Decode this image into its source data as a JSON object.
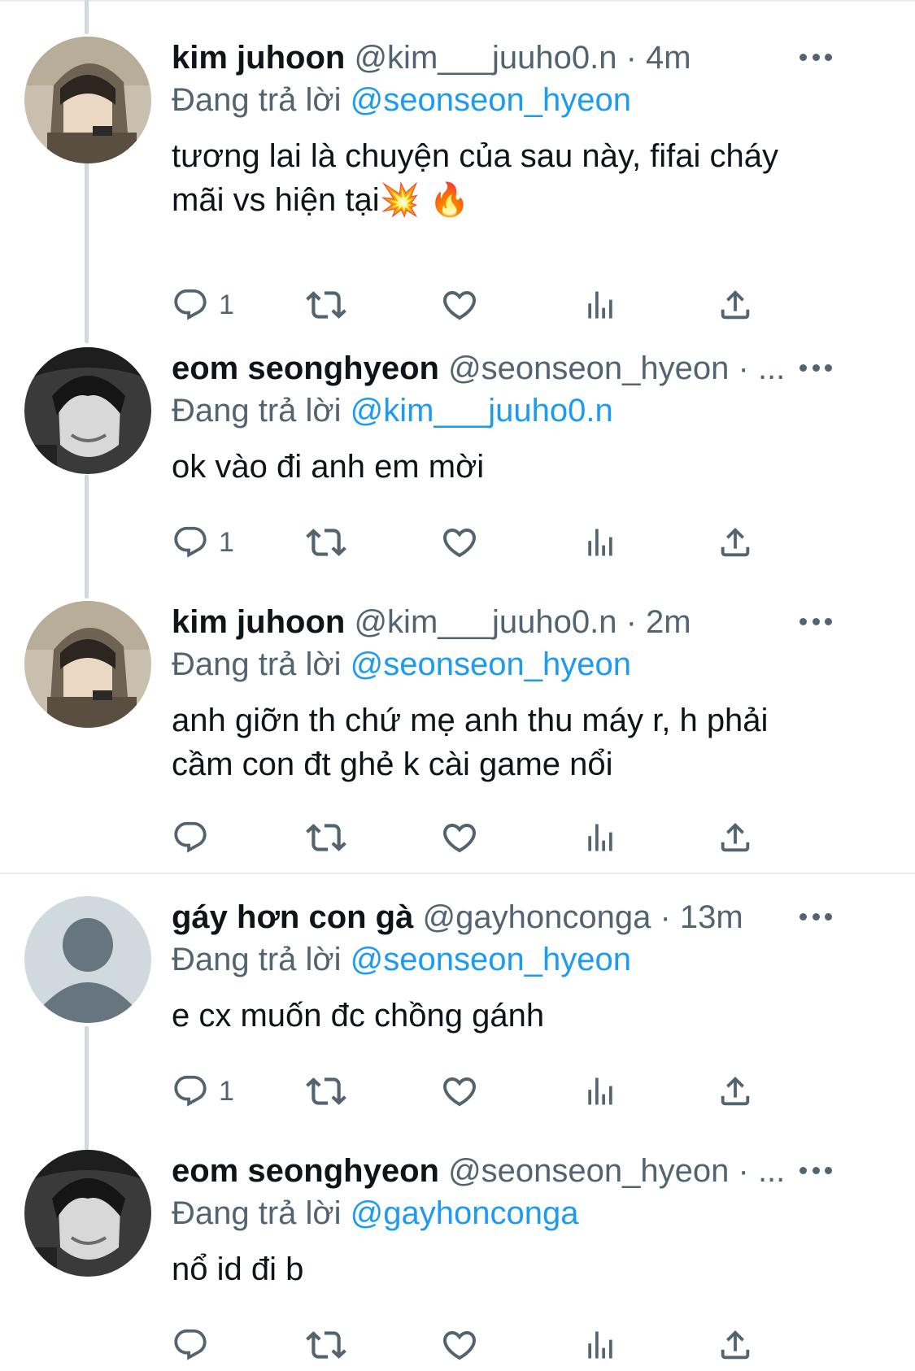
{
  "replying_label": "Đang trả lời",
  "tweets": [
    {
      "name": "kim juhoon",
      "handle": "@kim___juuho0.n",
      "sep": " · ",
      "time": "4m",
      "reply_to": "@seonseon_hyeon",
      "text": "tương lai là chuyện của sau này, fifai cháy\nmãi vs hiện tại💥 🔥",
      "reply_count": "1",
      "avatar": "photo-hooded-person"
    },
    {
      "name": "eom seonghyeon",
      "handle": "@seonseon_hyeon",
      "sep": " · ",
      "time": "...",
      "reply_to": "@kim___juuho0.n",
      "text": "ok vào đi anh em mời",
      "reply_count": "1",
      "avatar": "photo-grayscale-person"
    },
    {
      "name": "kim juhoon",
      "handle": "@kim___juuho0.n",
      "sep": " · ",
      "time": "2m",
      "reply_to": "@seonseon_hyeon",
      "text": "anh giỡn th chứ mẹ anh thu máy r, h phải\ncầm con đt ghẻ k cài game nổi",
      "reply_count": "",
      "avatar": "photo-hooded-person"
    },
    {
      "name": "gáy hơn con gà",
      "handle": "@gayhonconga",
      "sep": " · ",
      "time": "13m",
      "reply_to": "@seonseon_hyeon",
      "text": "e cx muốn đc chồng gánh",
      "reply_count": "1",
      "avatar": "default-profile-icon"
    },
    {
      "name": "eom seonghyeon",
      "handle": "@seonseon_hyeon",
      "sep": " · ",
      "time": "...",
      "reply_to": "@gayhonconga",
      "text": "nổ id đi b",
      "reply_count": "",
      "avatar": "photo-grayscale-person"
    }
  ],
  "colors": {
    "text": "#0f1419",
    "secondary": "#536471",
    "accent": "#1d9bf0",
    "thread_line": "#cfd9de",
    "divider": "#e7e9ea"
  },
  "icons": [
    "reply-icon",
    "retweet-icon",
    "like-icon",
    "views-icon",
    "share-icon",
    "more-icon"
  ]
}
